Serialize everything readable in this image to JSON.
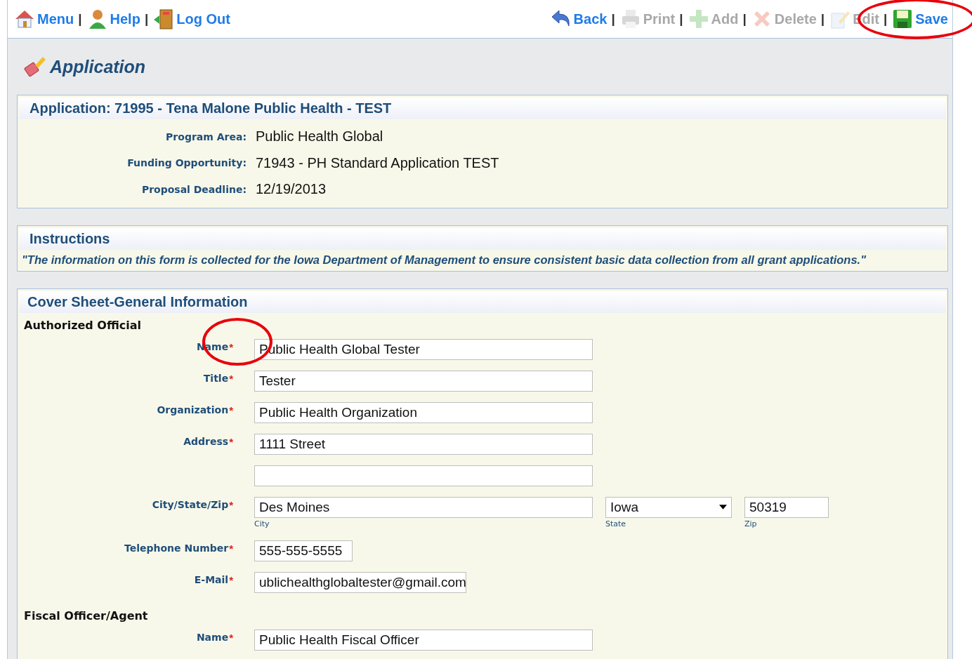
{
  "nav_left": [
    {
      "kind": "link",
      "label": "Menu"
    },
    {
      "kind": "separator",
      "label": "|"
    },
    {
      "kind": "link",
      "label": "Help"
    },
    {
      "kind": "separator",
      "label": "|"
    },
    {
      "kind": "link",
      "label": "Log Out"
    }
  ],
  "nav_right": [
    {
      "kind": "link",
      "label": "Back",
      "disabled": false,
      "highlighted": false
    },
    {
      "kind": "separator",
      "label": "|"
    },
    {
      "kind": "link",
      "label": "Print",
      "disabled": true,
      "highlighted": false
    },
    {
      "kind": "separator",
      "label": "|"
    },
    {
      "kind": "link",
      "label": "Add",
      "disabled": true,
      "highlighted": false
    },
    {
      "kind": "separator",
      "label": "|"
    },
    {
      "kind": "link",
      "label": "Delete",
      "disabled": true,
      "highlighted": false
    },
    {
      "kind": "separator",
      "label": "|"
    },
    {
      "kind": "link",
      "label": "Edit",
      "disabled": true,
      "highlighted": false
    },
    {
      "kind": "separator",
      "label": "|"
    },
    {
      "kind": "link",
      "label": "Save",
      "disabled": false,
      "highlighted": true
    }
  ],
  "page_title": "Application",
  "summary": {
    "heading": "Application: 71995 - Tena Malone Public Health - TEST",
    "items": [
      {
        "label": "Program Area:",
        "value": "Public Health Global"
      },
      {
        "label": "Funding Opportunity:",
        "value": "71943 - PH Standard Application TEST"
      },
      {
        "label": "Proposal Deadline:",
        "value": "12/19/2013"
      }
    ]
  },
  "instructions": {
    "heading": "Instructions",
    "text": "\"The information on this form is collected for the Iowa Department of Management to ensure consistent basic data collection from all grant applications.\""
  },
  "cover_sheet": {
    "heading": "Cover Sheet-General Information",
    "groups": [
      {
        "title": "Authorized Official",
        "rows": [
          {
            "label": "Name",
            "required_mark": "*",
            "highlighted": true,
            "inputs": [
              {
                "kind": "long-text",
                "value": "Public Health Global Tester"
              }
            ]
          },
          {
            "label": "Title",
            "required_mark": "*",
            "highlighted": false,
            "inputs": [
              {
                "kind": "long-text",
                "value": "Tester"
              }
            ]
          },
          {
            "label": "Organization",
            "required_mark": "*",
            "highlighted": false,
            "inputs": [
              {
                "kind": "long-text",
                "value": "Public Health Organization"
              }
            ]
          },
          {
            "label": "Address",
            "required_mark": "*",
            "highlighted": false,
            "inputs": [
              {
                "kind": "long-text",
                "value": "1111 Street"
              }
            ]
          },
          {
            "highlighted": false,
            "inputs": [
              {
                "kind": "long-text"
              }
            ]
          },
          {
            "label": "City/State/Zip",
            "required_mark": "*",
            "highlighted": false,
            "inputs": [
              {
                "kind": "long-text",
                "value": "Des Moines",
                "caption": "City"
              },
              {
                "kind": "select",
                "value": "Iowa",
                "caption": "State"
              },
              {
                "kind": "short-text",
                "value": "50319",
                "caption": "Zip"
              }
            ]
          },
          {
            "label": "Telephone Number",
            "required_mark": "*",
            "highlighted": false,
            "inputs": [
              {
                "kind": "phone-text",
                "value": "555-555-5555"
              }
            ]
          },
          {
            "label": "E-Mail",
            "required_mark": "*",
            "highlighted": false,
            "inputs": [
              {
                "kind": "email-text",
                "value": "ublichealthglobaltester@gmail.com"
              }
            ]
          }
        ]
      },
      {
        "title": "Fiscal Officer/Agent",
        "rows": [
          {
            "label": "Name",
            "required_mark": "*",
            "highlighted": false,
            "inputs": [
              {
                "kind": "long-text",
                "value": "Public Health Fiscal Officer"
              }
            ]
          }
        ]
      }
    ]
  }
}
